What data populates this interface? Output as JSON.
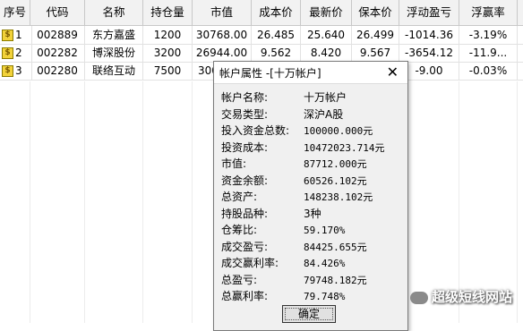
{
  "table": {
    "headers": [
      "序号",
      "代码",
      "名称",
      "持仓量",
      "市值",
      "成本价",
      "最新价",
      "保本价",
      "浮动盈亏",
      "浮赢率"
    ],
    "rows": [
      {
        "idx": "1",
        "code": "002889",
        "name": "东方嘉盛",
        "qty": "1200",
        "value": "30768.00",
        "cost": "26.485",
        "last": "25.640",
        "breakeven": "26.499",
        "pnl": "-1014.36",
        "rate": "-3.19%"
      },
      {
        "idx": "2",
        "code": "002282",
        "name": "博深股份",
        "qty": "3200",
        "value": "26944.00",
        "cost": "9.562",
        "last": "8.420",
        "breakeven": "9.567",
        "pnl": "-3654.12",
        "rate": "-11.9..."
      },
      {
        "idx": "3",
        "code": "002280",
        "name": "联络互动",
        "qty": "7500",
        "value": "300...",
        "cost": "",
        "last": "",
        "breakeven": "",
        "pnl": "-9.00",
        "rate": "-0.03%"
      }
    ],
    "row_icon": "dollar-icon"
  },
  "dialog": {
    "title": "帐户属性 -[十万帐户]",
    "close": "✕",
    "fields": [
      {
        "label": "帐户名称:",
        "value": "十万帐户"
      },
      {
        "label": "交易类型:",
        "value": "深沪A股"
      },
      {
        "label": "投入资金总数:",
        "value": "100000.000元"
      },
      {
        "label": "投资成本:",
        "value": "10472023.714元"
      },
      {
        "label": "市值:",
        "value": "87712.000元"
      },
      {
        "label": "资金余额:",
        "value": "60526.102元"
      },
      {
        "label": "总资产:",
        "value": "148238.102元"
      },
      {
        "label": "持股品种:",
        "value": "3种"
      },
      {
        "label": "仓筹比:",
        "value": "59.170%"
      },
      {
        "label": "成交盈亏:",
        "value": "84425.655元"
      },
      {
        "label": "成交赢利率:",
        "value": "84.426%"
      },
      {
        "label": "总盈亏:",
        "value": "79748.182元"
      },
      {
        "label": "总赢利率:",
        "value": "79.748%"
      }
    ],
    "ok_label": "确定"
  },
  "watermark": {
    "text": "超级短线网站",
    "icon": "wechat-icon"
  }
}
